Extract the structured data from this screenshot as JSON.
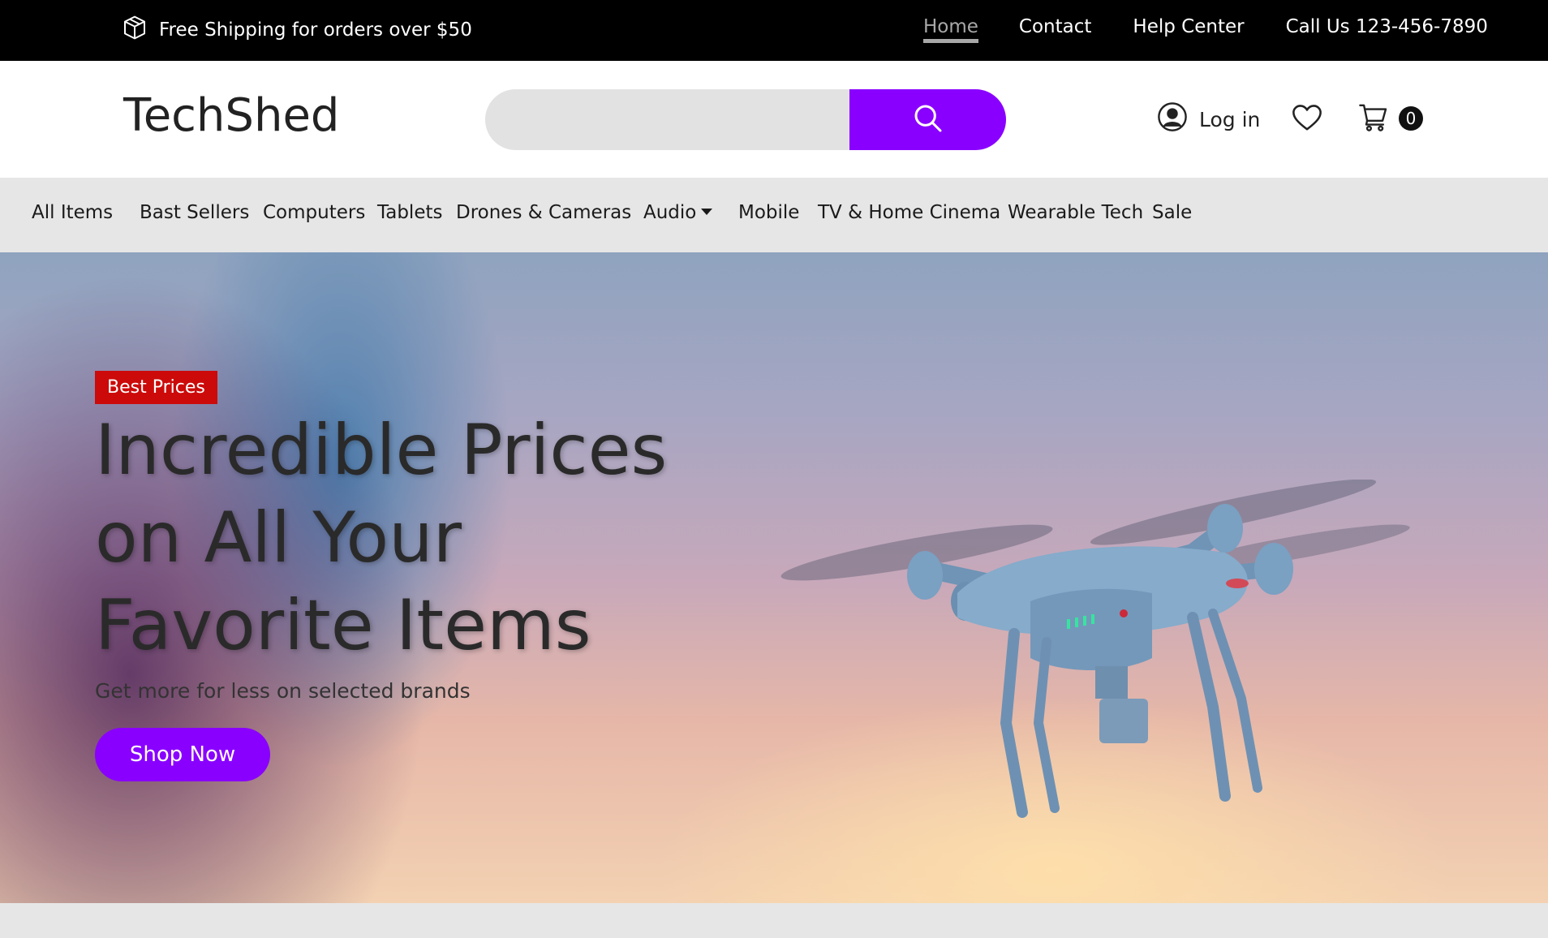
{
  "topbar": {
    "shipping_text": "Free Shipping for orders over $50",
    "links": {
      "home": "Home",
      "contact": "Contact",
      "help": "Help Center",
      "call": "Call Us 123-456-7890"
    }
  },
  "header": {
    "logo": "TechShed",
    "search": {
      "placeholder": ""
    },
    "login_label": "Log in",
    "cart_count": "0"
  },
  "categories": [
    "All Items",
    "Bast Sellers",
    "Computers",
    "Tablets",
    "Drones & Cameras",
    "Audio",
    "Mobile",
    "TV & Home Cinema",
    "Wearable Tech",
    "Sale"
  ],
  "hero": {
    "badge": "Best Prices",
    "headline_line1": "Incredible Prices",
    "headline_line2": "on All Your",
    "headline_line3": "Favorite Items",
    "subtitle": "Get more for less on selected brands",
    "cta": "Shop Now"
  },
  "colors": {
    "accent": "#8a00ff",
    "badge": "#cc0a0a",
    "topbar": "#000000",
    "nav_bg": "#e6e6e6"
  },
  "icons": [
    "box-icon",
    "search-icon",
    "user-icon",
    "heart-icon",
    "cart-icon",
    "caret-down-icon"
  ]
}
